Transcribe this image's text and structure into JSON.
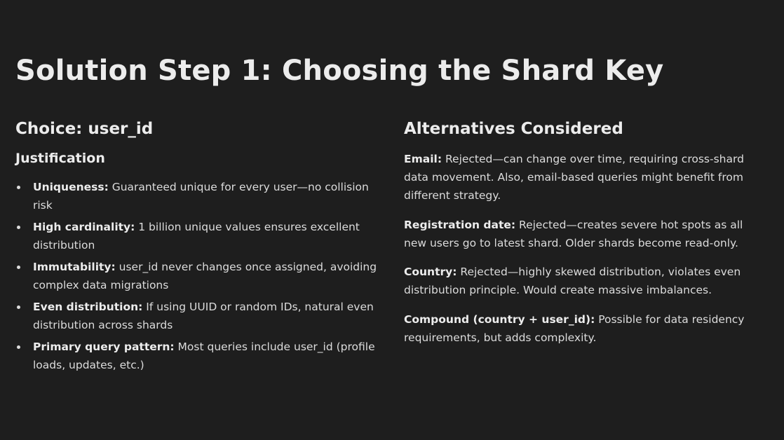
{
  "title": "Solution Step 1: Choosing the Shard Key",
  "left": {
    "heading": "Choice: user_id",
    "subheading": "Justification",
    "items": [
      {
        "label": "Uniqueness:",
        "text": " Guaranteed unique for every user—no collision risk"
      },
      {
        "label": "High cardinality:",
        "text": " 1 billion unique values ensures excellent distribution"
      },
      {
        "label": "Immutability:",
        "text": " user_id never changes once assigned, avoiding complex data migrations"
      },
      {
        "label": "Even distribution:",
        "text": " If using UUID or random IDs, natural even distribution across shards"
      },
      {
        "label": "Primary query pattern:",
        "text": " Most queries include user_id (profile loads, updates, etc.)"
      }
    ]
  },
  "right": {
    "heading": "Alternatives Considered",
    "items": [
      {
        "label": "Email:",
        "text": " Rejected—can change over time, requiring cross-shard data movement. Also, email-based queries might benefit from different strategy."
      },
      {
        "label": "Registration date:",
        "text": " Rejected—creates severe hot spots as all new users go to latest shard. Older shards become read-only."
      },
      {
        "label": "Country:",
        "text": " Rejected—highly skewed distribution, violates even distribution principle. Would create massive imbalances."
      },
      {
        "label": "Compound (country + user_id):",
        "text": " Possible for data residency requirements, but adds complexity."
      }
    ]
  }
}
